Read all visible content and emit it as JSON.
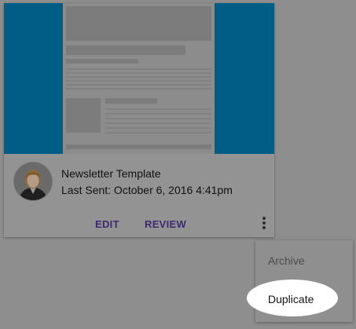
{
  "template_card": {
    "title": "Newsletter Template",
    "last_sent": "Last Sent: October 6, 2016 4:41pm",
    "edit_label": "EDIT",
    "review_label": "REVIEW",
    "more_icon": "more-vert-icon"
  },
  "menu": {
    "items": [
      {
        "label": "Archive"
      },
      {
        "label": "Duplicate"
      }
    ]
  },
  "colors": {
    "overlay": "#8e8e8e",
    "thumbnail_brand": "#005e86",
    "action_text": "#3d2a73",
    "highlight": "#ffffff"
  }
}
